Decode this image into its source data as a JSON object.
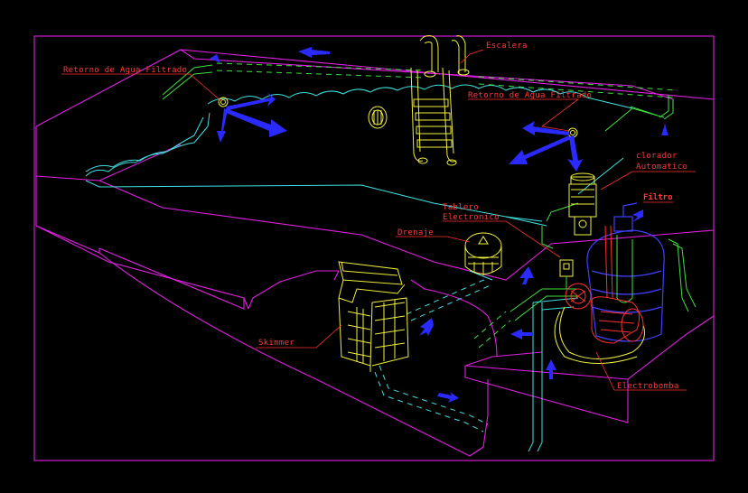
{
  "labels": {
    "retorno_left": "Retorno de Agua Filtrado",
    "retorno_right": "Retorno de Agua Filtrado",
    "escalera": "Escalera",
    "clorador_1": "clorador",
    "clorador_2": "Automatico",
    "filtro": "Filtro",
    "tablero_1": "Tablero",
    "tablero_2": "Electronico",
    "drenaje": "Drenaje",
    "skimmer": "Skimmer",
    "electrobomba": "Electrobomba"
  },
  "colors": {
    "frame": "#e020e0",
    "water": "#40e0e0",
    "equipment": "#f0f040",
    "piping": "#40e040",
    "labels": "#ff3b3b",
    "flow_arrows": "#2a2aff"
  }
}
